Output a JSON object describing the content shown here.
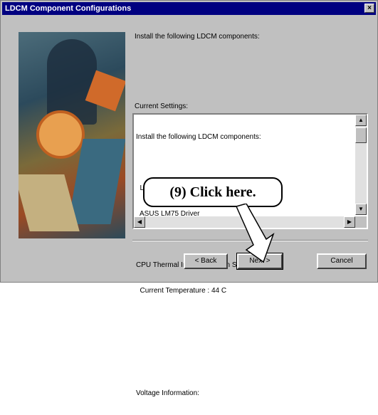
{
  "window": {
    "title": "LDCM Component Configurations",
    "close_glyph": "×"
  },
  "intro": "Install the following LDCM components:",
  "current_settings": {
    "label": "Current Settings:",
    "lines": [
      "Install the following LDCM components:",
      "",
      "  LM78 Driver",
      "  ASUS LM75 Driver",
      "",
      "CPU Thermal Instrumentation Settings",
      "  Current Temperature : 44 C",
      "",
      "",
      "",
      "Voltage Information:"
    ]
  },
  "scroll_glyphs": {
    "up": "▲",
    "down": "▼",
    "left": "◀",
    "right": "▶"
  },
  "buttons": {
    "back": "< Back",
    "next": "Next >",
    "cancel": "Cancel"
  },
  "annotation": {
    "callout": "(9)  Click here."
  },
  "colors": {
    "titlebar": "#000080",
    "face": "#c0c0c0"
  }
}
